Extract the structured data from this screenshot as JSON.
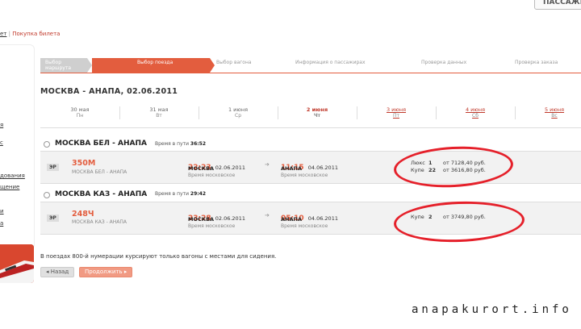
{
  "header": {
    "passengers_button": "ПАССАЖИ"
  },
  "breadcrumb": {
    "prev": "ет",
    "current": "Покупка билета"
  },
  "sidebar": {
    "items": [
      "я",
      "с",
      "дования",
      "щение",
      "и",
      "а"
    ]
  },
  "steps": [
    {
      "label": "Выбор маршрута",
      "state": "done"
    },
    {
      "label": "Выбор поезда",
      "state": "active"
    },
    {
      "label": "Выбор вагона",
      "state": "todo"
    },
    {
      "label": "Информация о пассажирах",
      "state": "todo"
    },
    {
      "label": "Проверка данных",
      "state": "todo"
    },
    {
      "label": "Проверка заказа",
      "state": "todo"
    }
  ],
  "route_title": "МОСКВА - АНАПА, 02.06.2011",
  "dates": [
    {
      "day": "30 мая",
      "dow": "Пн",
      "state": "normal"
    },
    {
      "day": "31 мая",
      "dow": "Вт",
      "state": "normal"
    },
    {
      "day": "1 июня",
      "dow": "Ср",
      "state": "normal"
    },
    {
      "day": "2 июня",
      "dow": "Чт",
      "state": "selected"
    },
    {
      "day": "3 июня",
      "dow": "Пт",
      "state": "link"
    },
    {
      "day": "4 июня",
      "dow": "Сб",
      "state": "link"
    },
    {
      "day": "5 июня",
      "dow": "Вс",
      "state": "link"
    }
  ],
  "stations": [
    {
      "station": "МОСКВА БЕЛ - АНАПА",
      "travel_label": "Время в пути",
      "travel_time": "36:52",
      "train": {
        "type": "ЭР",
        "number": "350М",
        "route": "МОСКВА БЕЛ - АНАПА",
        "dep_time": "22:23",
        "dep_date": "02.06.2011",
        "dep_city": "МОСКВА",
        "dep_tz": "Время московское",
        "arr_time": "11:15",
        "arr_date": "04.06.2011",
        "arr_city": "АНАПА",
        "arr_tz": "Время московское",
        "prices": [
          {
            "class": "Люкс",
            "count": "1",
            "price": "от 7128,40 руб."
          },
          {
            "class": "Купе",
            "count": "22",
            "price": "от 3616,80 руб."
          }
        ]
      }
    },
    {
      "station": "МОСКВА КАЗ - АНАПА",
      "travel_label": "Время в пути",
      "travel_time": "29:42",
      "train": {
        "type": "ЭР",
        "number": "248Ч",
        "route": "МОСКВА КАЗ - АНАПА",
        "dep_time": "23:28",
        "dep_date": "02.06.2011",
        "dep_city": "МОСКВА",
        "dep_tz": "Время московское",
        "arr_time": "05:10",
        "arr_date": "04.06.2011",
        "arr_city": "АНАПА",
        "arr_tz": "Время московское",
        "prices": [
          {
            "class": "Купе",
            "count": "2",
            "price": "от 3749,80 руб."
          }
        ]
      }
    }
  ],
  "note": "В поездах 800-й нумерации курсируют только вагоны с местами для сидения.",
  "buttons": {
    "back": "Назад",
    "next": "Продолжить"
  },
  "watermark": "anapakurort.info",
  "colors": {
    "accent": "#e35d3e",
    "annotation": "#e5202a"
  }
}
